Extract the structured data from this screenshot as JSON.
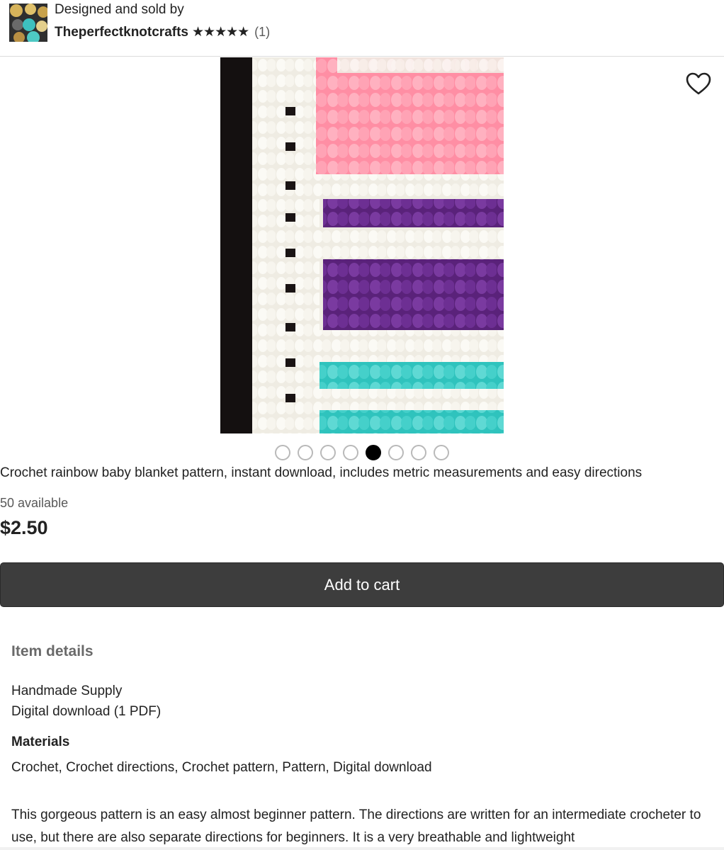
{
  "seller": {
    "designed_by": "Designed and sold by",
    "shop_name": "Theperfectknotcrafts",
    "stars": "★★★★★",
    "rating_value": 5,
    "review_count": "(1)"
  },
  "gallery": {
    "image_count": 8,
    "active_index": 4,
    "favorite_icon": "heart-icon"
  },
  "listing": {
    "title": "Crochet rainbow baby blanket pattern, instant download, includes metric measurements and easy directions",
    "availability": "50 available",
    "price": "$2.50",
    "add_to_cart_label": "Add to cart"
  },
  "details": {
    "heading": "Item details",
    "lines": [
      "Handmade Supply",
      "Digital download (1 PDF)"
    ],
    "materials_heading": "Materials",
    "materials": "Crochet, Crochet directions, Crochet pattern, Pattern, Digital download",
    "description": "This gorgeous pattern is an easy almost beginner pattern. The directions are written for an intermediate crocheter to use, but there are also separate directions for beginners. It is a very breathable and lightweight"
  },
  "colors": {
    "button_bg": "#3d3d3d",
    "active_dot": "#000000",
    "yarn_pink": "#ff9fb0",
    "yarn_purple": "#6a2c8e",
    "yarn_teal": "#3fcfc9",
    "yarn_white": "#f3f0e8"
  }
}
